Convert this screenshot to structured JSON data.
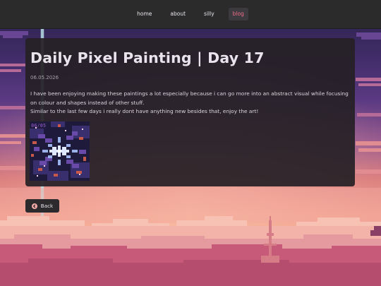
{
  "nav": {
    "items": [
      {
        "label": "home"
      },
      {
        "label": "about"
      },
      {
        "label": "silly"
      },
      {
        "label": "blog",
        "active": true
      }
    ]
  },
  "post": {
    "title": "Daily Pixel Painting | Day 17",
    "date": "06.05.2026",
    "paragraphs": [
      "I have been enjoying making these paintings a lot especially because i can go more into an abstract visual while focusing on colour and shapes instead of other stuff.",
      "Similar to the last few days i really dont have anything new besides that, enjoy the art!"
    ],
    "artwork": {
      "caption": "06/05",
      "icon": "pixel-art-starburst"
    }
  },
  "back_button": {
    "label": "Back",
    "icon": "back-arrow-icon"
  },
  "colors": {
    "nav_bg": "#2b2b2b",
    "accent": "#f06f8c",
    "panel_bg": "#262026",
    "text": "#e9e4ec"
  }
}
